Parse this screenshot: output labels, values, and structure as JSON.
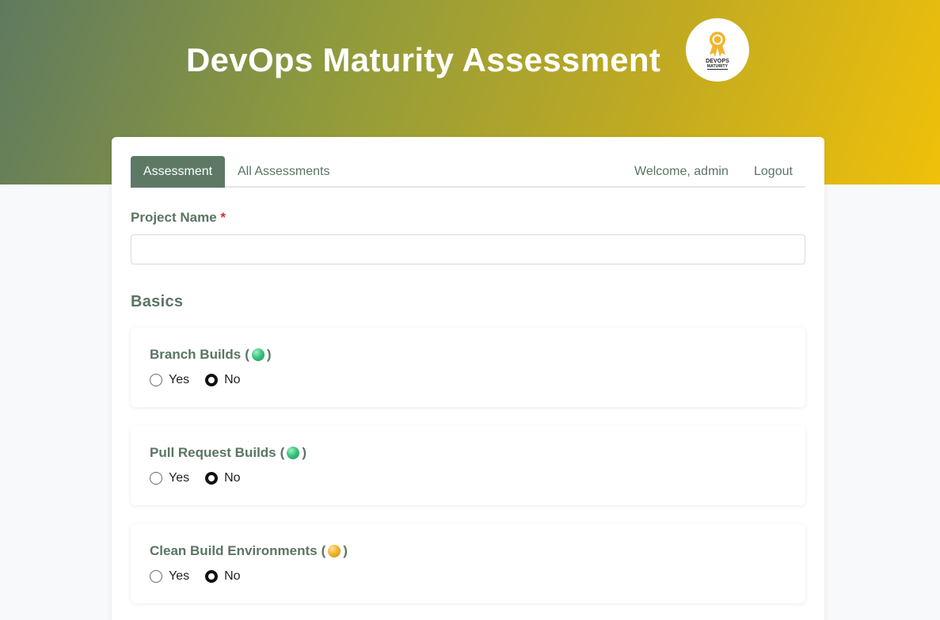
{
  "header": {
    "title": "DevOps Maturity Assessment"
  },
  "logo": {
    "line1": "DEVOPS",
    "line2": "MATURITY",
    "icon": "award-ribbon-icon"
  },
  "nav": {
    "tabs": [
      "Assessment",
      "All Assessments"
    ],
    "welcome": "Welcome, admin",
    "logout": "Logout"
  },
  "form": {
    "project_label": "Project Name",
    "required_marker": "*",
    "project_value": "",
    "project_placeholder": ""
  },
  "section": {
    "title": "Basics"
  },
  "questions": [
    {
      "name": "Branch Builds",
      "paren_open": "(",
      "paren_close": ")",
      "level_color": "green",
      "yes": "Yes",
      "no": "No",
      "selected": "No"
    },
    {
      "name": "Pull Request Builds",
      "paren_open": "(",
      "paren_close": ")",
      "level_color": "green",
      "yes": "Yes",
      "no": "No",
      "selected": "No"
    },
    {
      "name": "Clean Build Environments",
      "paren_open": "(",
      "paren_close": ")",
      "level_color": "yellow",
      "yes": "Yes",
      "no": "No",
      "selected": "No"
    }
  ],
  "colors": {
    "accent": "#5d7966",
    "gradient_start": "#5f7a5f",
    "gradient_end": "#f0c00a",
    "required": "#d22c2c",
    "level_green": "#3cc47e",
    "level_yellow": "#f0b52e"
  }
}
